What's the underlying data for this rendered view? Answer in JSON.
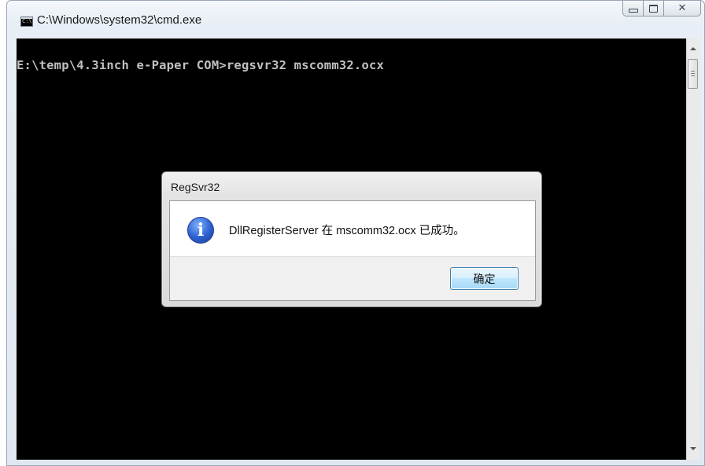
{
  "window": {
    "title": "C:\\Windows\\system32\\cmd.exe",
    "icon": "cmd-icon",
    "icon_text": "C:\\",
    "buttons": [
      "minimize",
      "maximize",
      "close"
    ],
    "close_glyph": "✕"
  },
  "console": {
    "lines": [
      "E:\\temp\\4.3inch e-Paper COM>regsvr32 mscomm32.ocx"
    ],
    "background": "#000000",
    "foreground": "#c0c0c0"
  },
  "dialog": {
    "title": "RegSvr32",
    "icon": "info-icon",
    "icon_glyph": "i",
    "message": "DllRegisterServer 在 mscomm32.ocx 已成功。",
    "ok_label": "确定"
  }
}
